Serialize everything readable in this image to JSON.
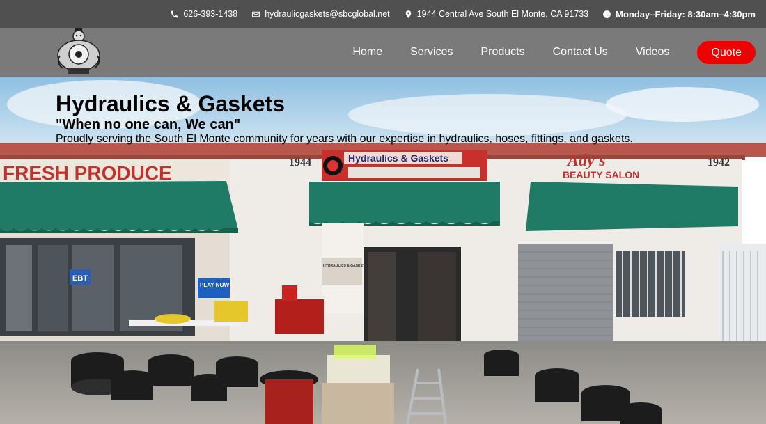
{
  "topbar": {
    "phone": "626-393-1438",
    "email": "hydraulicgaskets@sbcglobal.net",
    "address": "1944 Central Ave South El Monte, CA 91733",
    "hours": "Monday–Friday: 8:30am–4:30pm"
  },
  "nav": {
    "items": [
      "Home",
      "Services",
      "Products",
      "Contact Us",
      "Videos"
    ],
    "quote": "Quote"
  },
  "hero": {
    "title": "Hydraulics & Gaskets",
    "tagline": "\"When no one can, We can\"",
    "description": "Proudly serving the South El Monte community for years with our expertise in hydraulics, hoses, fittings, and gaskets."
  },
  "storefront": {
    "sign_left": "FRESH PRODUCE",
    "number_left": "1944",
    "banner": "Hydraulics & Gaskets",
    "sign_right_line1": "Ady's",
    "sign_right_line2": "BEAUTY SALON",
    "number_right": "1942",
    "store_sign": "EBT",
    "store_sign_2": "PLAY NOW",
    "door_sign": "HYDRAULICS & GASKETS"
  },
  "colors": {
    "topbar": "#505050",
    "navbar": "#7a7a7a",
    "quote": "#ee0000",
    "awning": "#1f7a66",
    "sky": "#a9cfe8"
  }
}
